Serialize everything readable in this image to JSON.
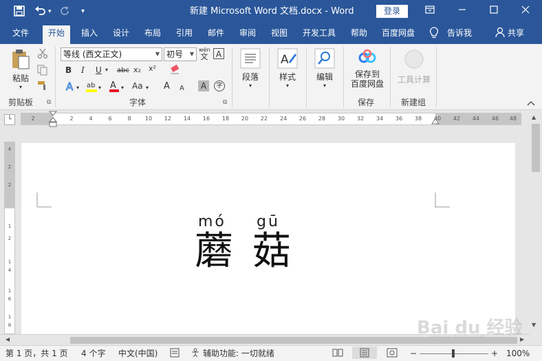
{
  "titlebar": {
    "title": "新建 Microsoft Word 文档.docx - Word",
    "login_label": "登录",
    "save_icon": "save-icon",
    "undo_icon": "undo-icon",
    "redo_icon": "redo-icon"
  },
  "tabs": [
    {
      "label": "文件"
    },
    {
      "label": "开始"
    },
    {
      "label": "插入"
    },
    {
      "label": "设计"
    },
    {
      "label": "布局"
    },
    {
      "label": "引用"
    },
    {
      "label": "邮件"
    },
    {
      "label": "审阅"
    },
    {
      "label": "视图"
    },
    {
      "label": "开发工具"
    },
    {
      "label": "帮助"
    },
    {
      "label": "百度网盘"
    }
  ],
  "tell_me": "告诉我",
  "share": "共享",
  "ribbon": {
    "clipboard": {
      "paste_label": "粘贴",
      "group_label": "剪贴板"
    },
    "font": {
      "font_name": "等线 (西文正文)",
      "font_size": "初号",
      "wen": "wén",
      "wen_char": "文",
      "a_box": "A",
      "bold": "B",
      "italic": "I",
      "underline": "U",
      "strike": "abc",
      "sub": "x₂",
      "sup": "x²",
      "aa": "Aa",
      "grow": "A",
      "shrink": "A",
      "char_shade": "A",
      "enclose": "字",
      "group_label": "字体"
    },
    "paragraph": {
      "label": "段落"
    },
    "styles": {
      "label": "样式"
    },
    "editing": {
      "label": "编辑"
    },
    "save": {
      "line1": "保存到",
      "line2": "百度网盘",
      "group_label": "保存"
    },
    "tools": {
      "label": "工具计算",
      "group_label": "新建组"
    }
  },
  "ruler_ticks": [
    "2",
    "2",
    "4",
    "6",
    "8",
    "10",
    "12",
    "14",
    "16",
    "18",
    "20",
    "22",
    "24",
    "26",
    "28",
    "30",
    "32",
    "34",
    "36",
    "38",
    "40",
    "42",
    "44",
    "46",
    "48"
  ],
  "vruler_ticks": [
    "4",
    "2",
    "2",
    "1",
    "2",
    "1",
    "4",
    "1",
    "6",
    "1",
    "8"
  ],
  "document": {
    "pinyin1": "mó",
    "pinyin2": "gū",
    "char1": "蘑",
    "char2": "菇"
  },
  "status": {
    "page": "第 1 页，共 1 页",
    "words": "4 个字",
    "lang": "中文(中国)",
    "accessibility": "辅助功能: 一切就绪",
    "zoom": "100%",
    "zoom_minus": "−",
    "zoom_plus": "+"
  },
  "watermark": {
    "text": "Bai du 经验",
    "url": "jingyan.baidu.com"
  }
}
